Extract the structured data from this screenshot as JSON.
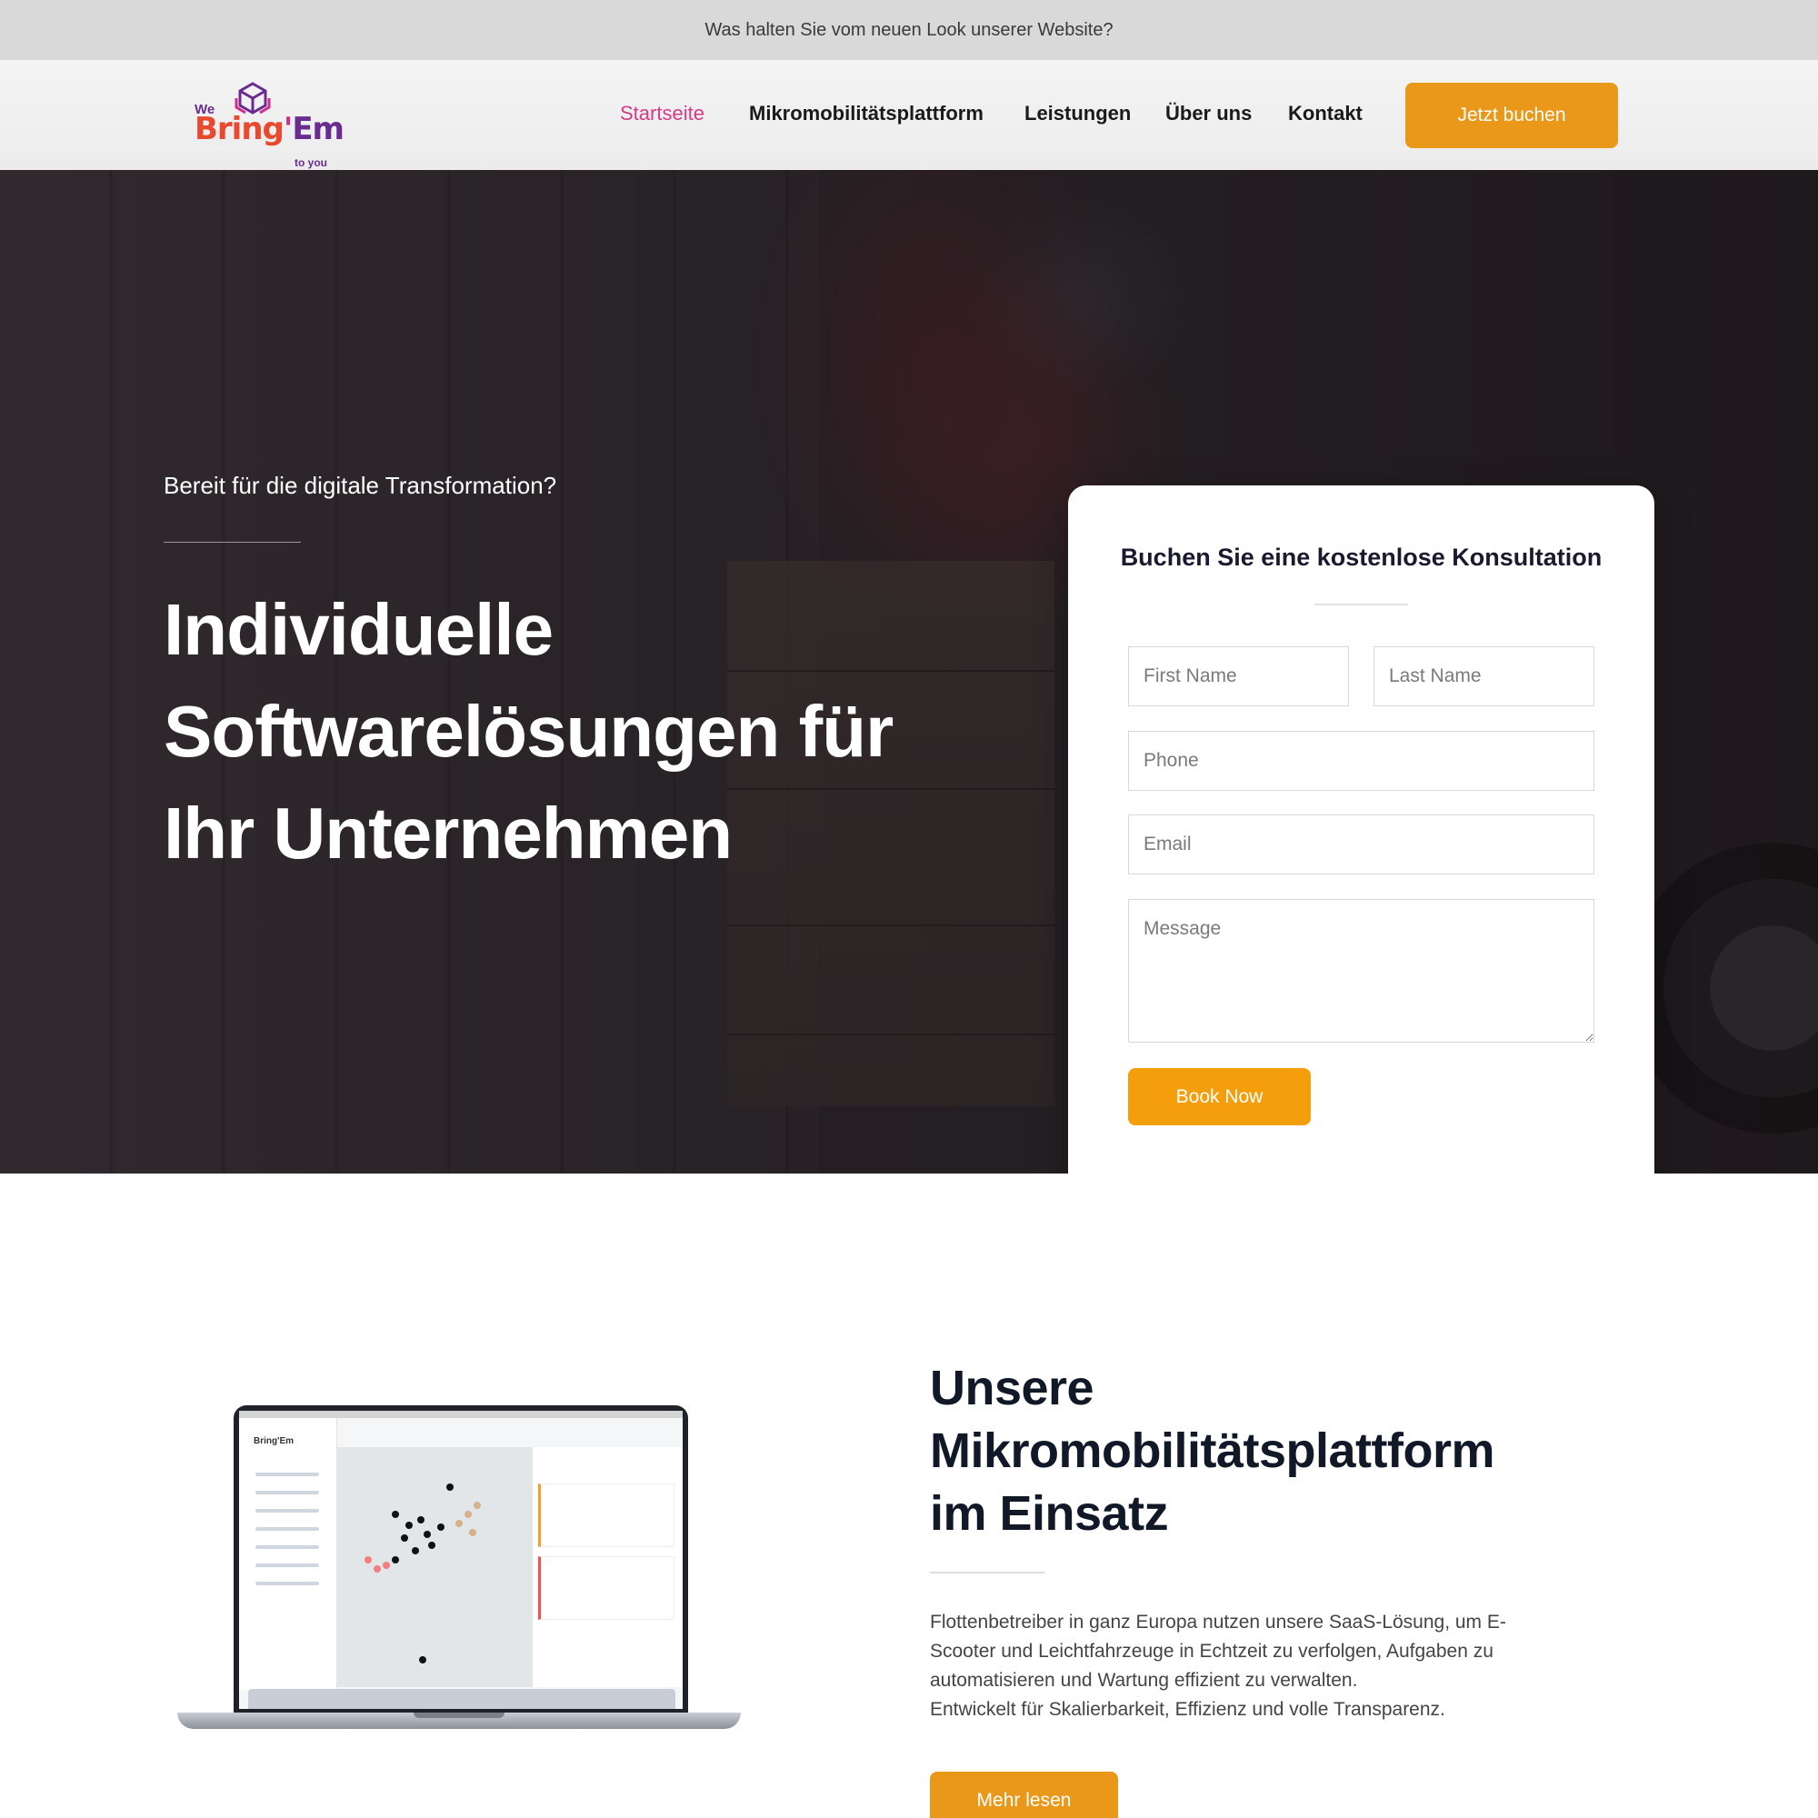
{
  "topbar": {
    "text": "Was halten Sie vom neuen Look unserer Website?"
  },
  "logo": {
    "we": "We",
    "bring": "Bring",
    "apos": "'",
    "em": "Em",
    "to_you": "to you"
  },
  "nav": {
    "items": [
      {
        "label": "Startseite",
        "active": true
      },
      {
        "label": "Mikromobilitätsplattform",
        "active": false
      },
      {
        "label": "Leistungen",
        "active": false
      },
      {
        "label": "Über uns",
        "active": false
      },
      {
        "label": "Kontakt",
        "active": false
      }
    ],
    "cta_label": "Jetzt buchen"
  },
  "hero": {
    "kicker": "Bereit für die digitale Transformation?",
    "title_lines": [
      "Individuelle",
      "Softwarelösungen für",
      "Ihr Unternehmen"
    ]
  },
  "form": {
    "title": "Buchen Sie eine kostenlose Konsultation",
    "first_name_placeholder": "First Name",
    "last_name_placeholder": "Last Name",
    "phone_placeholder": "Phone",
    "email_placeholder": "Email",
    "message_placeholder": "Message",
    "submit_label": "Book Now"
  },
  "platform": {
    "title_lines": [
      "Unsere",
      "Mikromobilitätsplattform",
      "im Einsatz"
    ],
    "body_lines": [
      "Flottenbetreiber in ganz Europa nutzen unsere SaaS-Lösung, um E-",
      "Scooter und Leichtfahrzeuge in Echtzeit zu verfolgen, Aufgaben zu",
      "automatisieren und Wartung effizient zu verwalten.",
      "Entwickelt für Skalierbarkeit, Effizienz und volle Transparenz."
    ],
    "more_label": "Mehr lesen"
  },
  "colors": {
    "accent": "#e9981a",
    "active_nav": "#d63b86",
    "hero_overlay": "#2f2a2d"
  }
}
